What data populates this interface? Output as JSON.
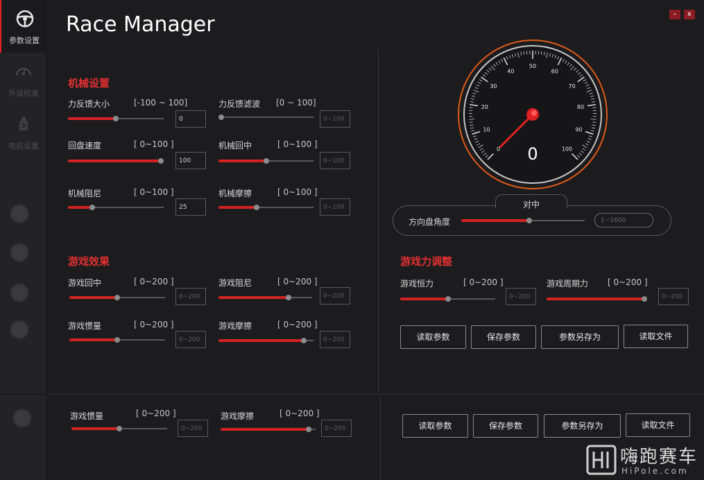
{
  "app": {
    "title": "Race Manager",
    "minimize": "–",
    "close": "x"
  },
  "sidebar": {
    "items": [
      {
        "label": "参数设置",
        "icon": "steering-wheel-icon"
      },
      {
        "label": "外设校准",
        "icon": "gauge-icon"
      },
      {
        "label": "电机设置",
        "icon": "motor-icon"
      }
    ]
  },
  "mechanical": {
    "title": "机械设置",
    "params": [
      {
        "label": "力反馈大小",
        "range": "[-100 ~ 100]",
        "value": "0",
        "placeholder": "",
        "level": 0.5
      },
      {
        "label": "力反馈滤波",
        "range": "[0 ~ 100]",
        "value": "",
        "placeholder": "0~100",
        "level": 0.03
      },
      {
        "label": "回盘速度",
        "range": "[ 0~100 ]",
        "value": "100",
        "placeholder": "",
        "level": 1.0
      },
      {
        "label": "机械回中",
        "range": "[ 0~100 ]",
        "value": "",
        "placeholder": "0~100",
        "level": 0.5
      },
      {
        "label": "机械阻尼",
        "range": "[ 0~100 ]",
        "value": "25",
        "placeholder": "",
        "level": 0.25
      },
      {
        "label": "机械摩擦",
        "range": "[ 0~100 ]",
        "value": "",
        "placeholder": "0~100",
        "level": 0.4
      }
    ]
  },
  "game_effects": {
    "title": "游戏效果",
    "params": [
      {
        "label": "游戏回中",
        "range": "[ 0~200 ]",
        "value": "",
        "placeholder": "0~200",
        "level": 0.5
      },
      {
        "label": "游戏阻尼",
        "range": "[ 0~200 ]",
        "value": "",
        "placeholder": "0~200",
        "level": 0.75
      },
      {
        "label": "游戏惯量",
        "range": "[ 0~200 ]",
        "value": "",
        "placeholder": "0~200",
        "level": 0.5
      },
      {
        "label": "游戏摩擦",
        "range": "[ 0~200 ]",
        "value": "",
        "placeholder": "0~200",
        "level": 0.9
      }
    ]
  },
  "speedometer": {
    "value": "0",
    "ticks": [
      "0",
      "10",
      "20",
      "30",
      "40",
      "50",
      "60",
      "70",
      "80",
      "90",
      "100"
    ],
    "needle_value": 0,
    "accent": "#e02020"
  },
  "wheel": {
    "center_label": "对中",
    "angle_label": "方向盘角度",
    "angle_placeholder": "1~1600",
    "level": 0.55
  },
  "game_force": {
    "title": "游戏力调整",
    "params": [
      {
        "label": "游戏恒力",
        "range": "[ 0~200 ]",
        "value": "",
        "placeholder": "0~200",
        "level": 0.5
      },
      {
        "label": "游戏周期力",
        "range": "[ 0~200 ]",
        "value": "",
        "placeholder": "0~200",
        "level": 1.0
      }
    ]
  },
  "buttons": {
    "read_params": "读取参数",
    "save_params": "保存参数",
    "save_as": "参数另存为",
    "read_file": "读取文件"
  },
  "bottom": {
    "params": [
      {
        "label": "游戏惯量",
        "range": "[ 0~200 ]",
        "value": "",
        "placeholder": "0~200",
        "level": 0.5
      },
      {
        "label": "游戏摩擦",
        "range": "[ 0~200 ]",
        "value": "",
        "placeholder": "0~200",
        "level": 0.93
      }
    ]
  },
  "watermark": {
    "cn": "嗨跑赛车",
    "en": "HiPole.com"
  }
}
